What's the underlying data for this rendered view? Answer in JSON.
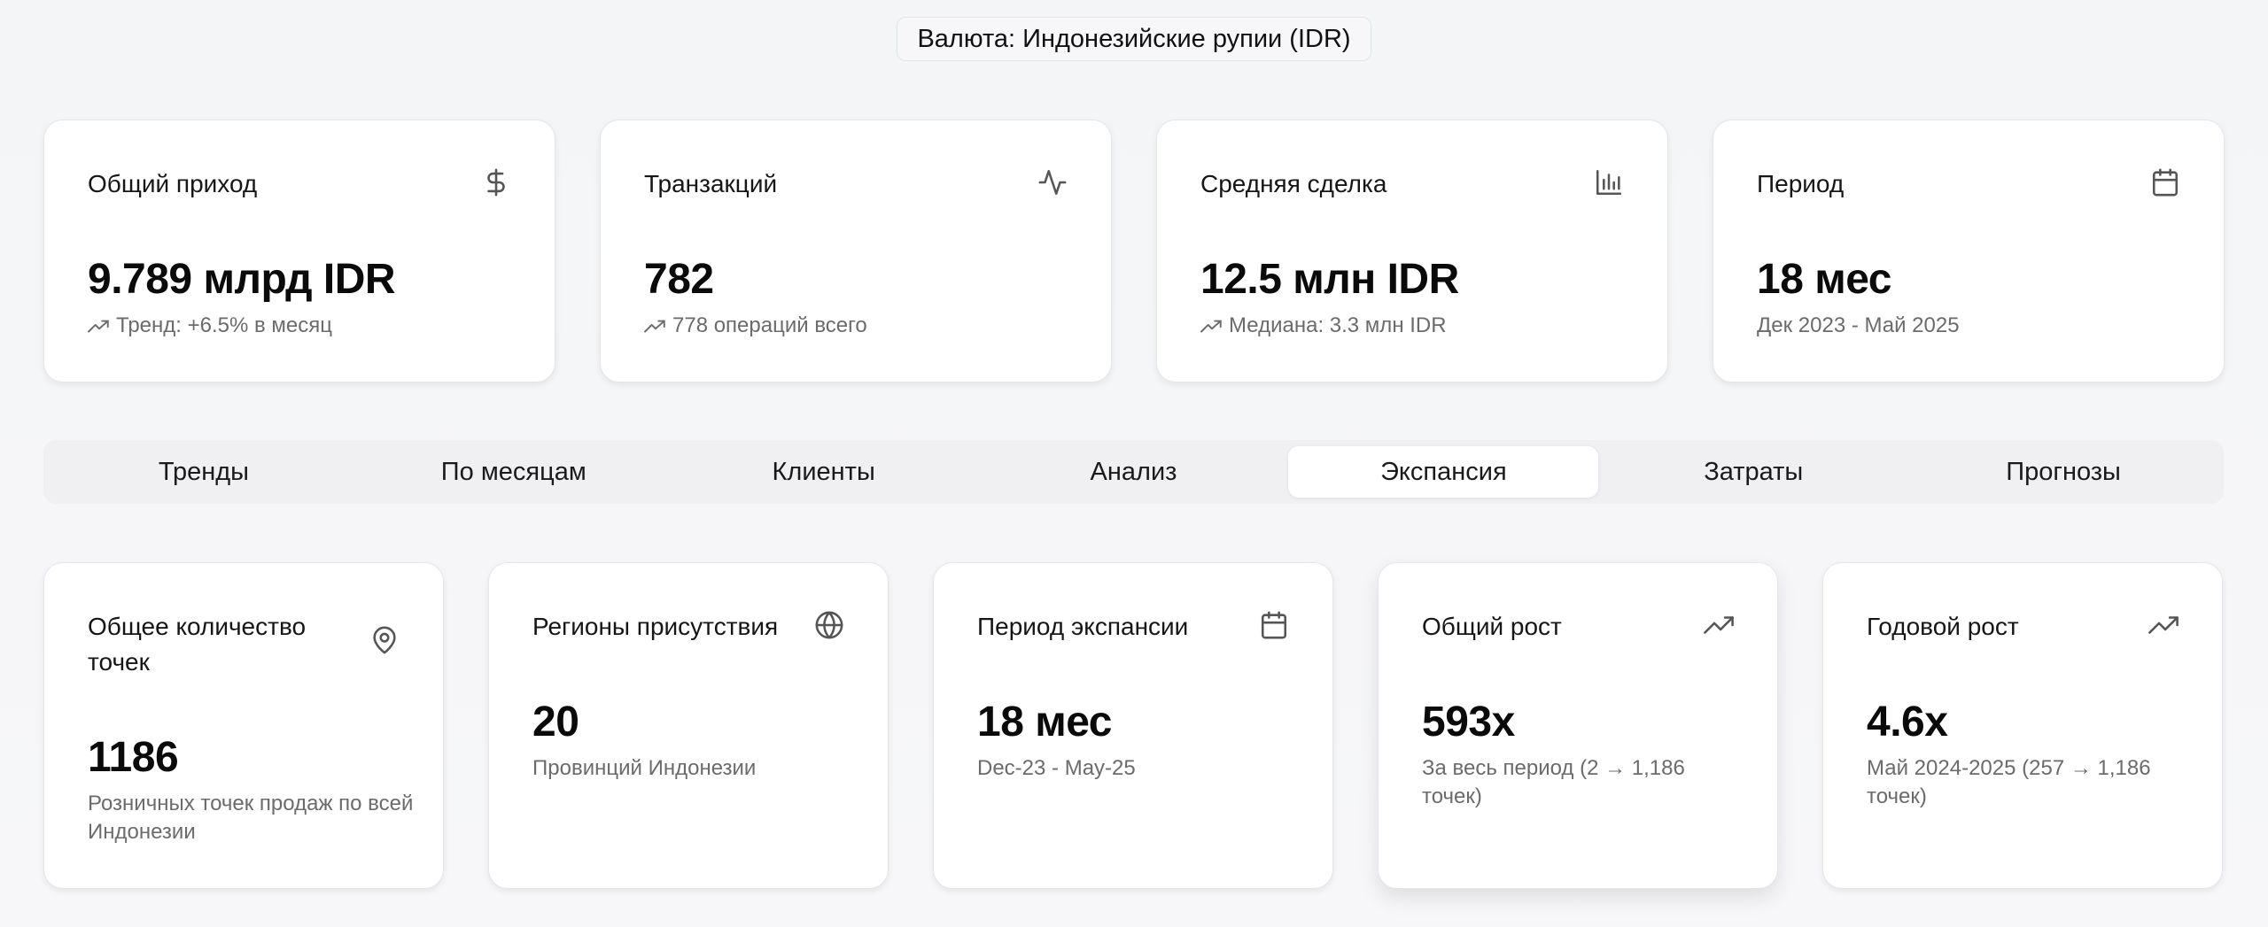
{
  "currency_label": "Валюта: Индонезийские рупии (IDR)",
  "kpis": [
    {
      "title": "Общий приход",
      "icon": "dollar-icon",
      "value": "9.789 млрд IDR",
      "sub": "Тренд: +6.5% в месяц",
      "trend": true
    },
    {
      "title": "Транзакций",
      "icon": "activity-icon",
      "value": "782",
      "sub": "778 операций всего",
      "trend": true
    },
    {
      "title": "Средняя сделка",
      "icon": "bar-chart-icon",
      "value": "12.5 млн IDR",
      "sub": "Медиана: 3.3 млн IDR",
      "trend": true
    },
    {
      "title": "Период",
      "icon": "calendar-icon",
      "value": "18 мес",
      "sub": "Дек 2023 - Май 2025",
      "trend": false
    }
  ],
  "tabs": [
    {
      "label": "Тренды"
    },
    {
      "label": "По месяцам"
    },
    {
      "label": "Клиенты"
    },
    {
      "label": "Анализ"
    },
    {
      "label": "Экспансия",
      "active": true
    },
    {
      "label": "Затраты"
    },
    {
      "label": "Прогнозы"
    }
  ],
  "expansion_metrics": [
    {
      "title": "Общее количество точек",
      "icon": "map-pin-icon",
      "value": "1186",
      "sub": "Розничных точек продаж по всей Индонезии"
    },
    {
      "title": "Регионы присутствия",
      "icon": "globe-icon",
      "value": "20",
      "sub": "Провинций Индонезии"
    },
    {
      "title": "Период экспансии",
      "icon": "calendar-icon",
      "value": "18 мес",
      "sub": "Dec-23 - May-25"
    },
    {
      "title": "Общий рост",
      "icon": "trending-up-icon",
      "value": "593x",
      "sub": "За весь период (2 → 1,186 точек)"
    },
    {
      "title": "Годовой рост",
      "icon": "trending-up-icon",
      "value": "4.6x",
      "sub": "Май 2024-2025 (257 → 1,186 точек)"
    }
  ]
}
